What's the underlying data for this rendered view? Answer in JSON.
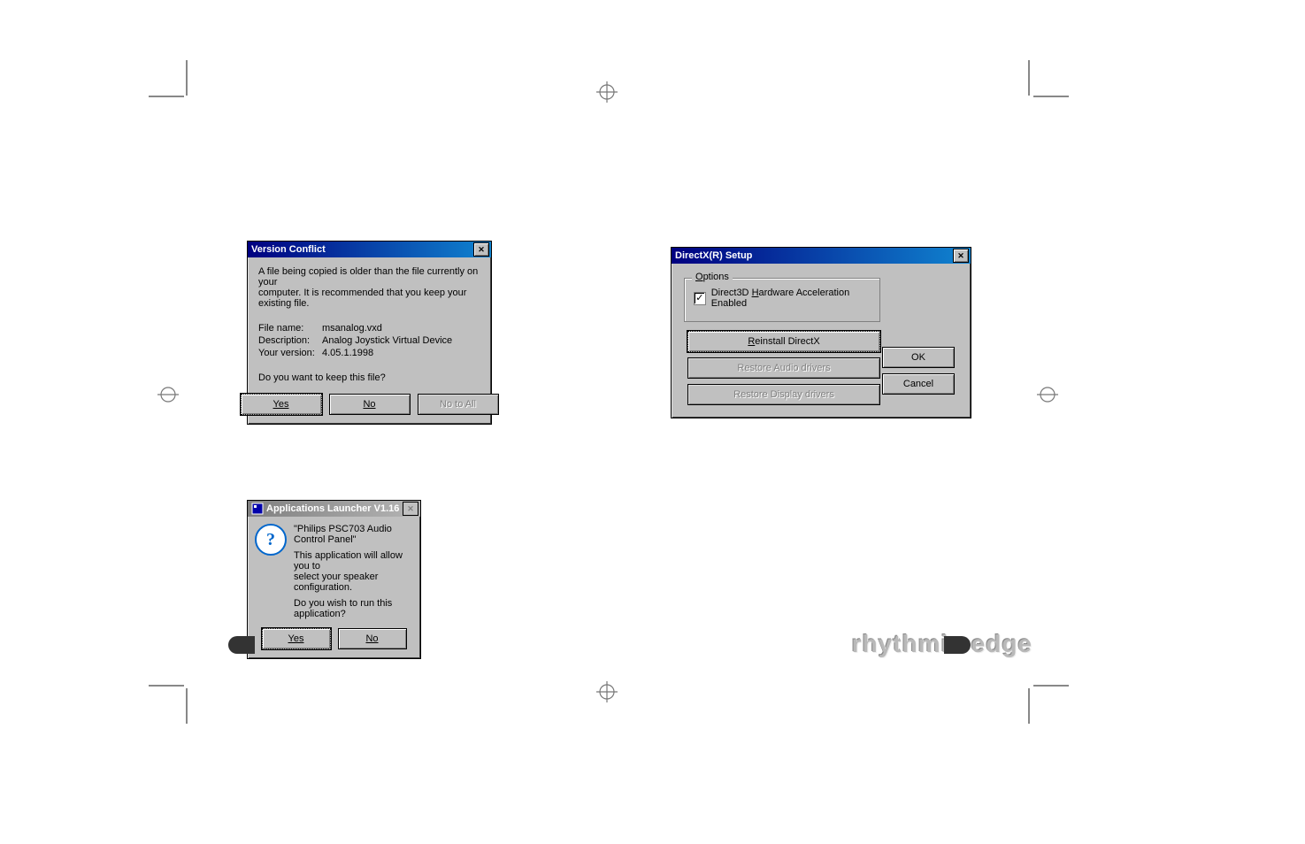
{
  "dlg_version_conflict": {
    "title": "Version Conflict",
    "message1": "A file being copied is older than the file currently on your",
    "message2": "computer. It is recommended that you keep your existing file.",
    "file_name_label": "File name:",
    "file_name": "msanalog.vxd",
    "description_label": "Description:",
    "description": "Analog Joystick Virtual Device",
    "your_version_label": "Your version:",
    "your_version": "4.05.1.1998",
    "prompt": "Do you want to keep this file?",
    "yes": "Yes",
    "no": "No",
    "no_to_all": "No to All"
  },
  "dlg_directx": {
    "title": "DirectX(R) Setup",
    "options_legend": "Options",
    "checkbox_label": "Direct3D Hardware Acceleration Enabled",
    "checkbox_checked": true,
    "reinstall": "Reinstall DirectX",
    "restore_audio": "Restore Audio drivers",
    "restore_display": "Restore Display drivers",
    "ok": "OK",
    "cancel": "Cancel"
  },
  "dlg_launcher": {
    "title": "Applications Launcher V1.16",
    "line1": "\"Philips PSC703 Audio Control Panel\"",
    "line2": "This application will allow you to",
    "line3": "select your speaker configuration.",
    "line4": "Do you wish to run this application?",
    "yes": "Yes",
    "no": "No"
  },
  "brand": "rhythmic edge"
}
